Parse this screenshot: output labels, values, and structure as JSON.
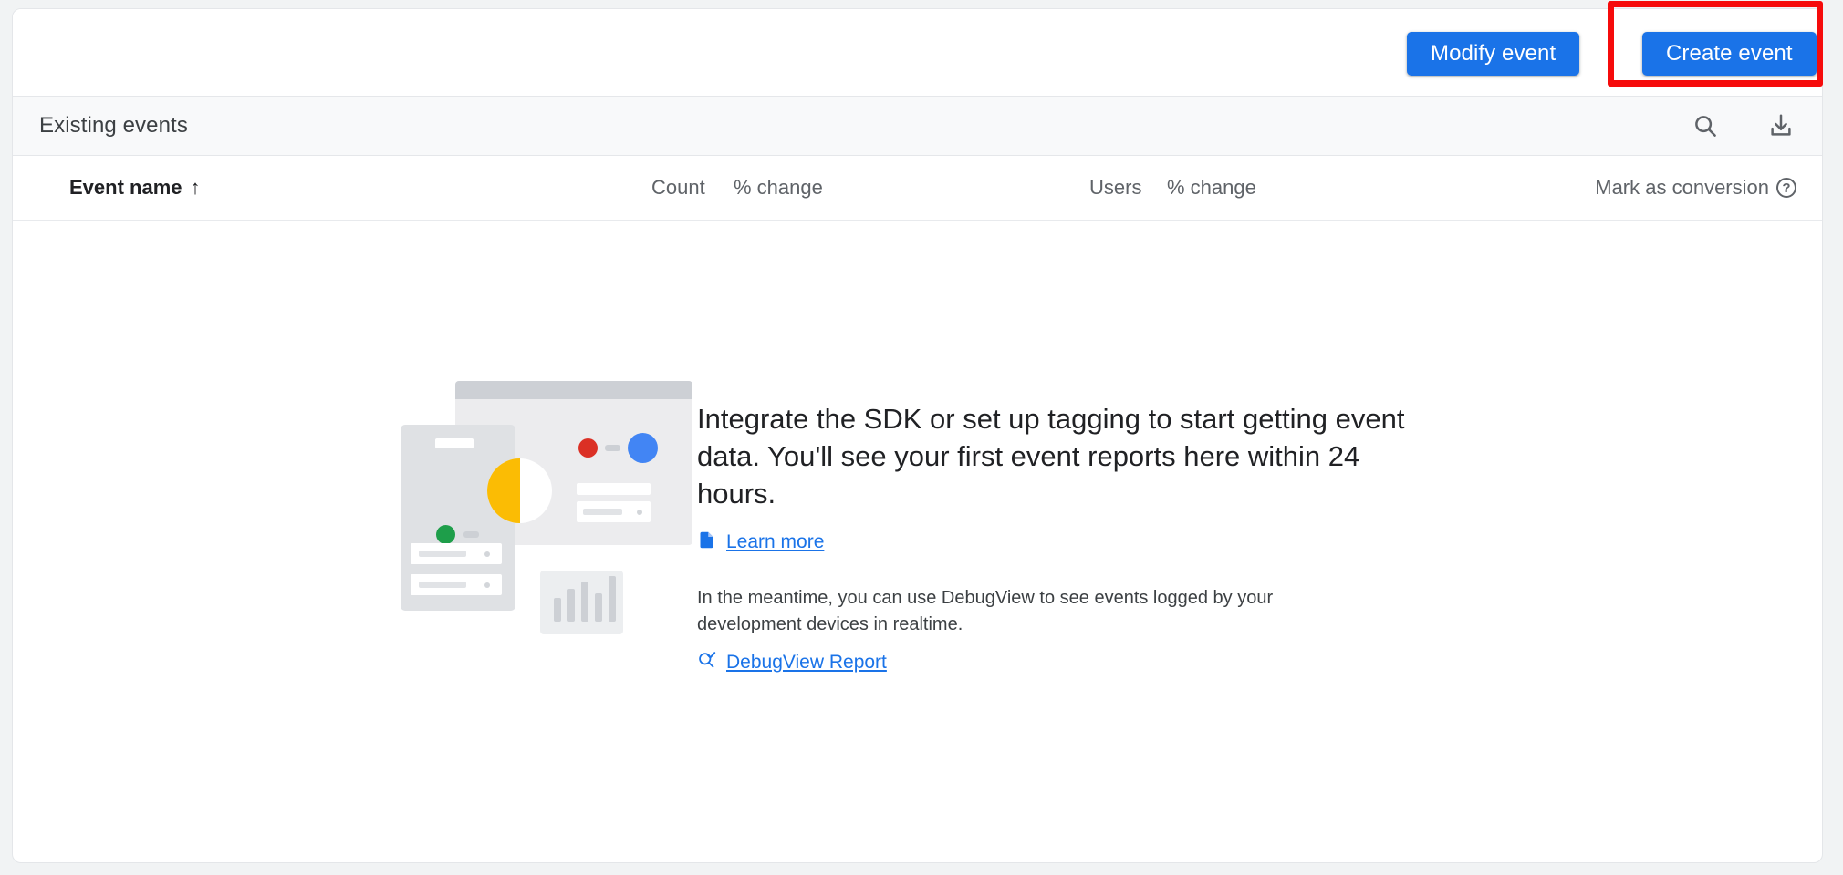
{
  "toolbar": {
    "modify_event_label": "Modify event",
    "create_event_label": "Create event",
    "accent_color": "#1a73e8",
    "highlight_color": "#f60b0b"
  },
  "events_panel": {
    "title": "Existing events",
    "search_icon": "search-icon",
    "download_icon": "download-icon"
  },
  "table": {
    "columns": {
      "event_name": "Event name",
      "sort_indicator": "↑",
      "count": "Count",
      "count_change": "% change",
      "users": "Users",
      "users_change": "% change",
      "mark_as_conversion": "Mark as conversion",
      "help_glyph": "?"
    },
    "rows": []
  },
  "empty_state": {
    "headline": "Integrate the SDK or set up tagging to start getting event data. You'll see your first event reports here within 24 hours.",
    "learn_more_label": "Learn more",
    "learn_more_icon": "article-icon",
    "body": "In the meantime, you can use DebugView to see events logged by your development devices in realtime.",
    "debugview_label": "DebugView Report",
    "debugview_icon": "debug-search-icon",
    "illustration": {
      "name": "empty-events-illustration",
      "chart_bars": [
        26,
        36,
        44,
        31,
        50
      ],
      "colors": {
        "green": "#1e9e4a",
        "red": "#db3025",
        "blue": "#4285f4",
        "yellow": "#fbbc04"
      }
    }
  }
}
